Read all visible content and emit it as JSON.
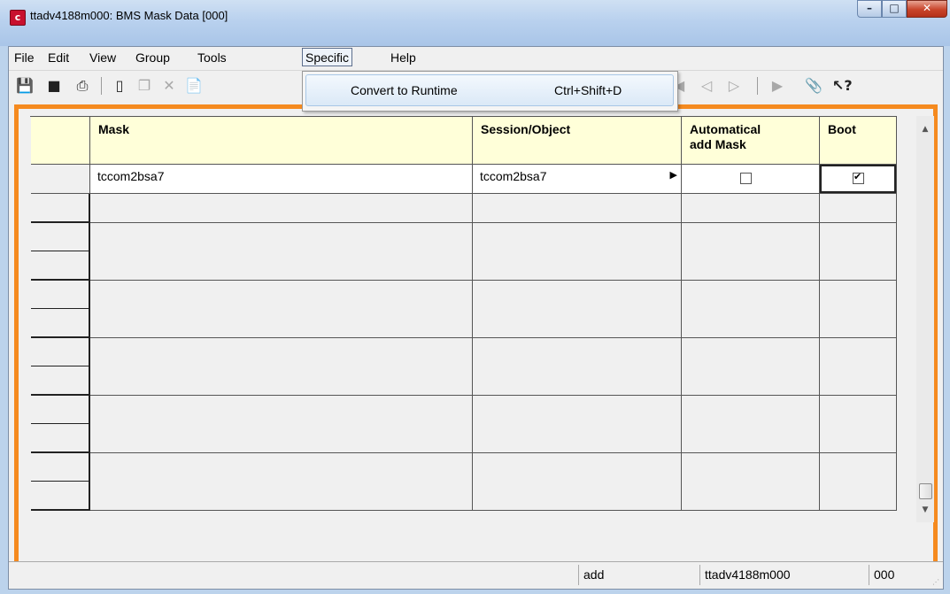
{
  "window": {
    "title": "ttadv4188m000: BMS Mask Data [000]",
    "icon": "app-logo-icon"
  },
  "titlebar_buttons": {
    "minimize": "minimize-icon",
    "maximize": "maximize-icon",
    "close": "close-icon"
  },
  "menubar": {
    "items": [
      "File",
      "Edit",
      "View",
      "Group",
      "Tools",
      "Specific",
      "Help"
    ],
    "active": "Specific"
  },
  "toolbar": {
    "icons": [
      "save-and-close-icon",
      "save-icon",
      "print-icon",
      "new-icon",
      "duplicate-icon",
      "delete-icon",
      "open-record-icon",
      "first-record-icon",
      "previous-record-icon",
      "next-record-icon",
      "last-record-icon",
      "attachment-icon",
      "context-help-icon"
    ]
  },
  "dropdown": {
    "items": [
      {
        "label": "Convert to Runtime",
        "shortcut": "Ctrl+Shift+D"
      }
    ]
  },
  "grid": {
    "columns": [
      {
        "label_line1": "Mask",
        "label_line2": ""
      },
      {
        "label_line1": "Session/Object",
        "label_line2": ""
      },
      {
        "label_line1": "Automatical",
        "label_line2": "add Mask"
      },
      {
        "label_line1": "Boot",
        "label_line2": ""
      }
    ],
    "rows": [
      {
        "mask": "tccom2bsa7",
        "session_object": "tccom2bsa7",
        "auto_add_mask": false,
        "boot": true
      }
    ],
    "empty_rows": 11
  },
  "statusbar": {
    "mode": "add",
    "session": "ttadv4188m000",
    "company": "000"
  },
  "colors": {
    "frame": "#f58a1f",
    "header_bg": "#ffffd9"
  }
}
